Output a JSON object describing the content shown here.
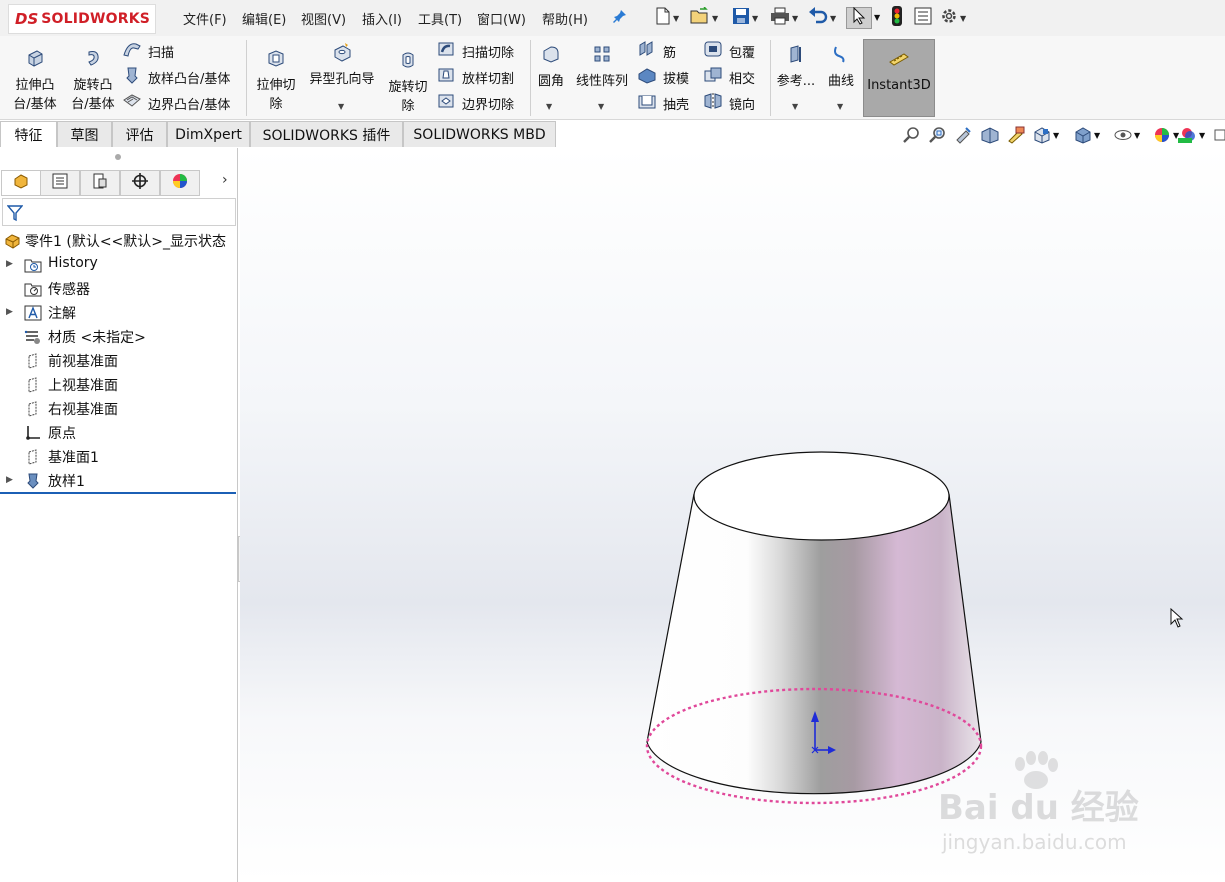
{
  "app": {
    "logo_ds": "DS",
    "logo_text": "SOLIDWORKS"
  },
  "menu": {
    "items": [
      "文件(F)",
      "编辑(E)",
      "视图(V)",
      "插入(I)",
      "工具(T)",
      "窗口(W)",
      "帮助(H)"
    ]
  },
  "quick_access": {
    "icons": [
      "new-document-icon",
      "open-icon",
      "save-icon",
      "print-icon",
      "undo-icon",
      "select-arrow-icon",
      "rebuild-traffic-light-icon",
      "file-properties-icon",
      "options-gear-icon"
    ]
  },
  "ribbon": {
    "extrude_boss": "拉伸凸\n台/基体",
    "revolve_boss": "旋转凸\n台/基体",
    "sweep": "扫描",
    "loft_boss": "放样凸台/基体",
    "boundary_boss": "边界凸台/基体",
    "extrude_cut": "拉伸切\n除",
    "hole_wizard": "异型孔向导",
    "revolve_cut": "旋转切\n除",
    "sweep_cut": "扫描切除",
    "loft_cut": "放样切割",
    "boundary_cut": "边界切除",
    "fillet": "圆角",
    "linear_pattern": "线性阵列",
    "rib": "筋",
    "draft": "拔模",
    "shell": "抽壳",
    "wrap": "包覆",
    "intersect": "相交",
    "mirror": "镜向",
    "reference": "参考...",
    "curves": "曲线",
    "instant3d": "Instant3D"
  },
  "tabs": [
    "特征",
    "草图",
    "评估",
    "DimXpert",
    "SOLIDWORKS 插件",
    "SOLIDWORKS MBD"
  ],
  "active_tab": "特征",
  "feature_tree": {
    "root": "零件1  (默认<<默认>_显示状态",
    "items": [
      {
        "label": "History",
        "icon": "history-folder-icon",
        "expandable": true
      },
      {
        "label": "传感器",
        "icon": "sensors-icon",
        "expandable": false
      },
      {
        "label": "注解",
        "icon": "annotations-icon",
        "expandable": true
      },
      {
        "label": "材质 <未指定>",
        "icon": "material-icon",
        "expandable": false
      },
      {
        "label": "前视基准面",
        "icon": "plane-icon",
        "expandable": false
      },
      {
        "label": "上视基准面",
        "icon": "plane-icon",
        "expandable": false
      },
      {
        "label": "右视基准面",
        "icon": "plane-icon",
        "expandable": false
      },
      {
        "label": "原点",
        "icon": "origin-icon",
        "expandable": false
      },
      {
        "label": "基准面1",
        "icon": "plane-icon",
        "expandable": false
      },
      {
        "label": "放样1",
        "icon": "loft-feature-icon",
        "expandable": true
      }
    ]
  },
  "watermark": {
    "brand": "Bai du 经验",
    "url": "jingyan.baidu.com"
  },
  "colors": {
    "accent_red": "#d01f27",
    "tree_separator": "#1b5fb5",
    "sketch_pink": "#e0489a",
    "instant3d_bg": "#a9a9a9"
  }
}
